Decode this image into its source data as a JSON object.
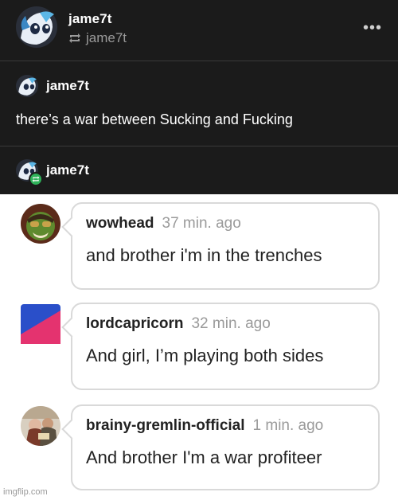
{
  "post": {
    "header": {
      "username": "jame7t",
      "reblog_from": "jame7t",
      "more_label": "•••"
    },
    "reblogs": [
      {
        "username": "jame7t",
        "text": "there’s a war between Sucking and Fucking"
      },
      {
        "username": "jame7t"
      }
    ],
    "colors": {
      "background": "#1b1b1b",
      "reblog_badge": "#2fb25a"
    }
  },
  "comments": [
    {
      "username": "wowhead",
      "time": "37 min. ago",
      "text": "and brother i'm in the trenches"
    },
    {
      "username": "lordcapricorn",
      "time": "32 min. ago",
      "text": "And girl, I’m playing both sides"
    },
    {
      "username": "brainy-gremlin-official",
      "time": "1 min. ago",
      "text": "And brother I'm a war profiteer"
    }
  ],
  "watermark": "imgflip.com"
}
